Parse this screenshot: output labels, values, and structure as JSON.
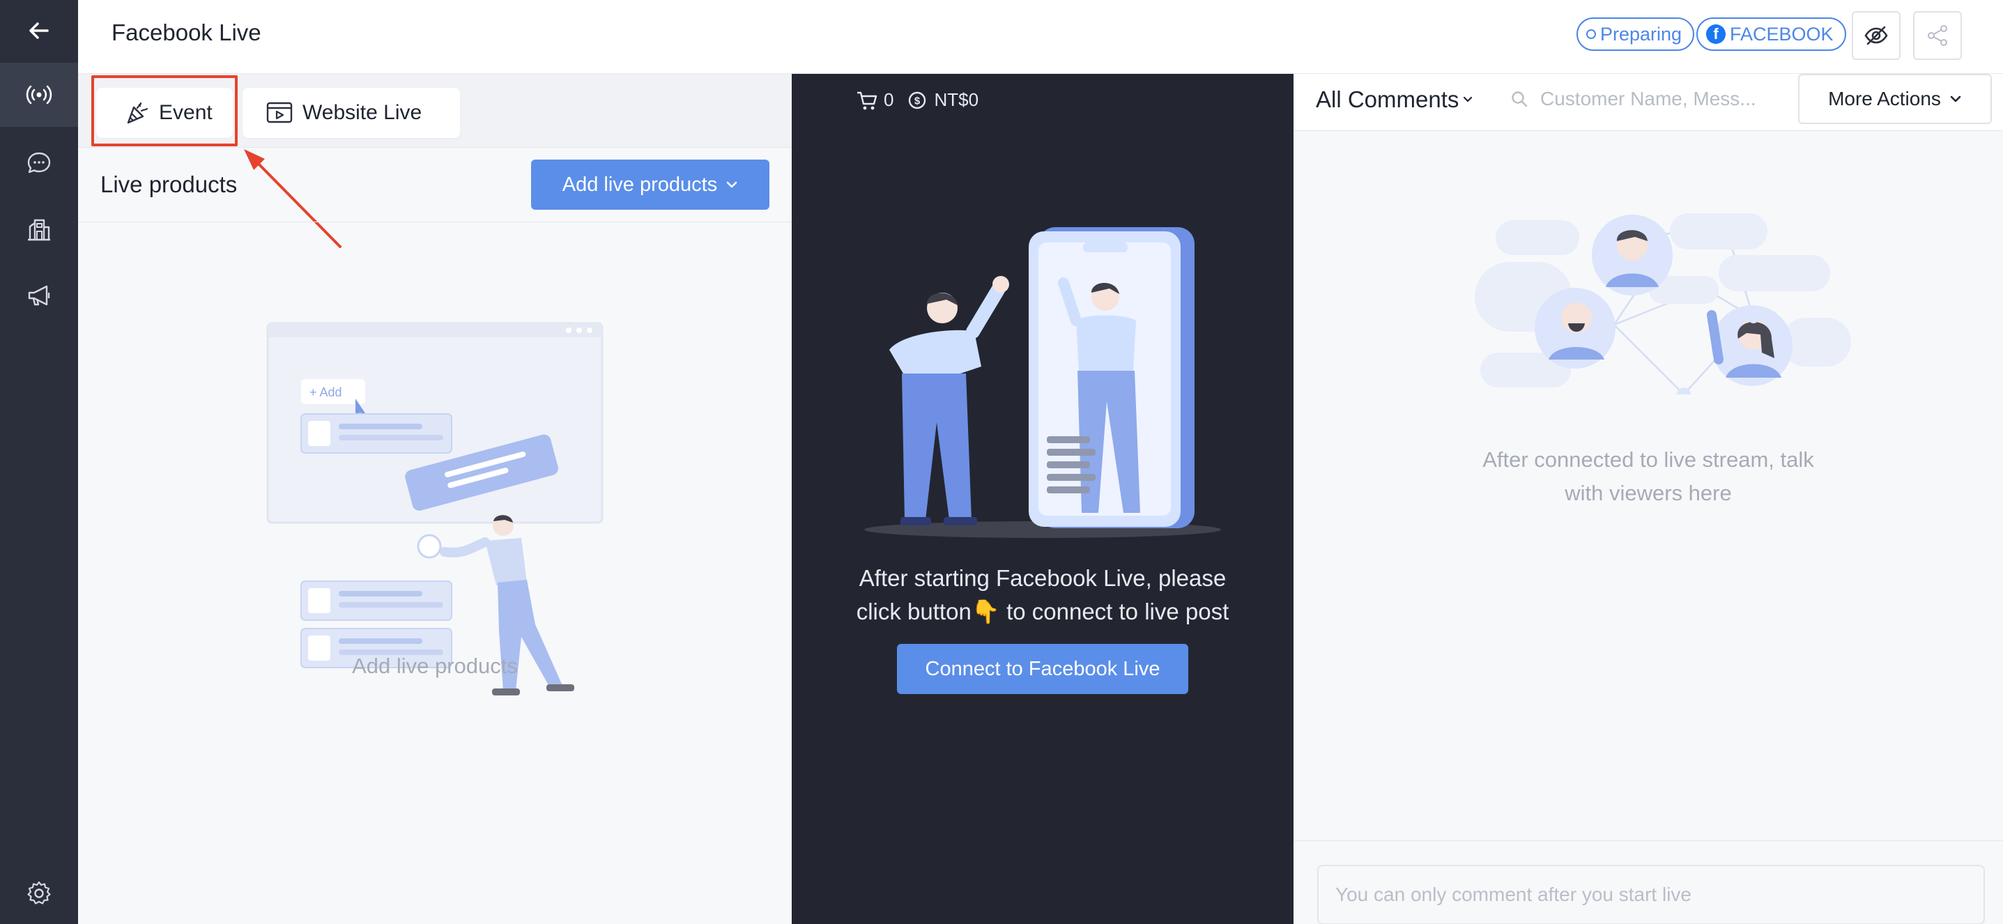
{
  "header": {
    "title": "Facebook Live",
    "status_badge": "Preparing",
    "platform_badge": "FACEBOOK"
  },
  "tabs": [
    {
      "label": "Event"
    },
    {
      "label": "Website Live"
    }
  ],
  "products": {
    "title": "Live products",
    "add_button": "Add live products",
    "empty_text": "Add live products",
    "illustration_add_label": "+ Add"
  },
  "stream": {
    "cart_count": "0",
    "revenue": "NT$0",
    "message_line1": "After starting Facebook Live, please",
    "message_line2_pre": "click button",
    "message_emoji": "👇",
    "message_line2_post": " to connect to live post",
    "connect_button": "Connect to Facebook Live"
  },
  "comments": {
    "filter_label": "All Comments",
    "search_placeholder": "Customer Name, Mess...",
    "more_actions": "More Actions",
    "empty_line1": "After connected to live stream, talk",
    "empty_line2": "with viewers here",
    "input_placeholder": "You can only comment after you start live"
  },
  "colors": {
    "sidebar": "#2b2f3c",
    "accent": "#5b8ee8",
    "dark_panel": "#232631",
    "highlight": "#e5432e"
  }
}
